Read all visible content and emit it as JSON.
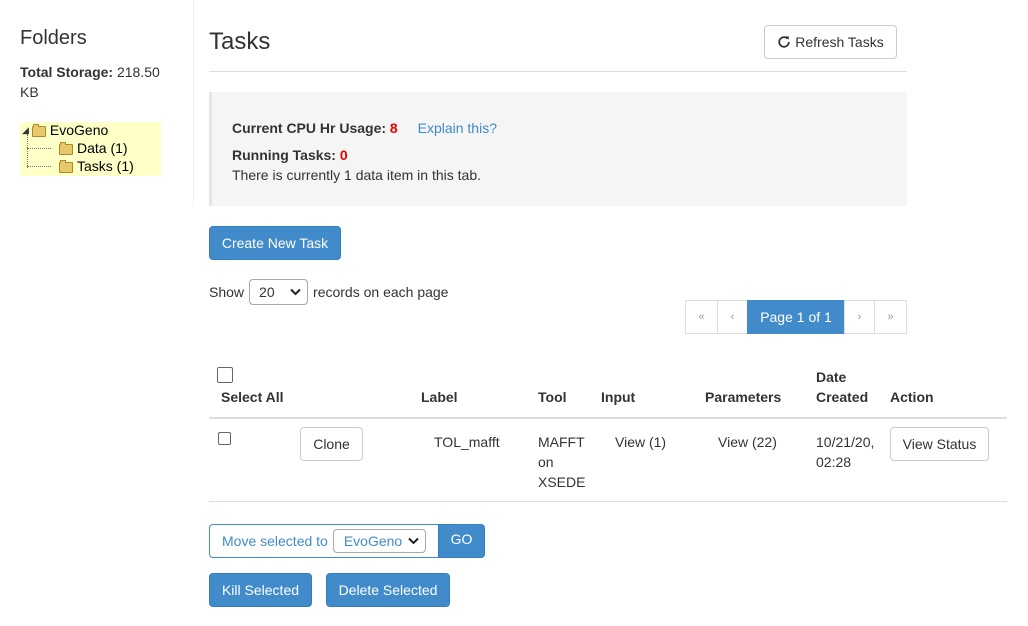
{
  "sidebar": {
    "title": "Folders",
    "storage_label": "Total Storage:",
    "storage_value": "218.50 KB",
    "tree": {
      "root": "EvoGeno",
      "children": [
        "Data (1)",
        "Tasks (1)"
      ]
    }
  },
  "header": {
    "title": "Tasks",
    "refresh_label": "Refresh Tasks"
  },
  "info": {
    "cpu_label": "Current CPU Hr Usage:",
    "cpu_value": "8",
    "explain_link": "Explain this?",
    "running_label": "Running Tasks:",
    "running_value": "0",
    "data_note": "There is currently 1 data item in this tab."
  },
  "actions": {
    "create_label": "Create New Task"
  },
  "pagination": {
    "show_label": "Show",
    "page_size": "20",
    "records_label": "records on each page",
    "first": "«",
    "prev": "‹",
    "current": "Page 1 of 1",
    "next": "›",
    "last": "»"
  },
  "table": {
    "headers": {
      "select_all": "Select All",
      "label": "Label",
      "tool": "Tool",
      "input": "Input",
      "parameters": "Parameters",
      "date_line1": "Date",
      "date_line2": "Created",
      "action": "Action"
    },
    "rows": [
      {
        "clone_label": "Clone",
        "label": "TOL_mafft",
        "tool_lines": [
          "MAFFT",
          "on",
          "XSEDE"
        ],
        "input": "View (1)",
        "parameters": "View (22)",
        "date_line1": "10/21/20,",
        "date_line2": "02:28",
        "action_label": "View Status"
      }
    ]
  },
  "bottom": {
    "move_label": "Move selected to",
    "move_target": "EvoGeno",
    "go_label": "GO",
    "kill_label": "Kill Selected",
    "delete_label": "Delete Selected"
  },
  "colors": {
    "primary": "#428bca",
    "tree_highlight": "#ffffc8",
    "alert_red": "#ee0000"
  }
}
